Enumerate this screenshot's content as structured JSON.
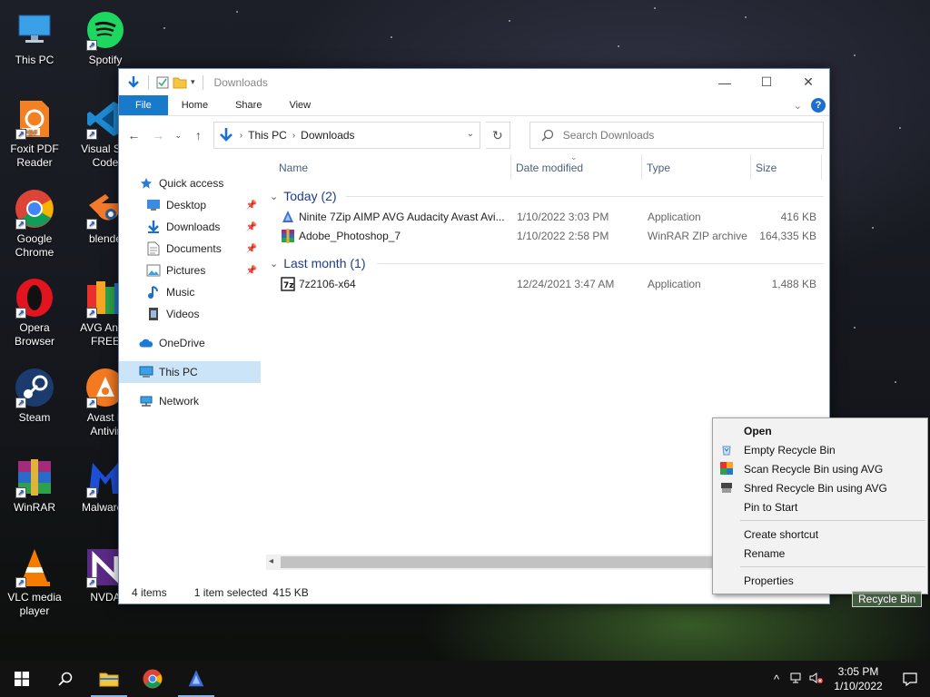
{
  "desktop": {
    "icons": [
      {
        "label": "This PC"
      },
      {
        "label": "Spotify"
      },
      {
        "label": "Foxit PDF\nReader"
      },
      {
        "label": "Visual Stu\nCode"
      },
      {
        "label": "Google\nChrome"
      },
      {
        "label": "blende"
      },
      {
        "label": "Opera\nBrowser"
      },
      {
        "label": "AVG AntiV\nFREE"
      },
      {
        "label": "Steam"
      },
      {
        "label": "Avast F\nAntivir"
      },
      {
        "label": "WinRAR"
      },
      {
        "label": "Malwareb"
      },
      {
        "label": "VLC media\nplayer"
      },
      {
        "label": "NVDA"
      }
    ],
    "recycle_bin_label": "Recycle Bin"
  },
  "explorer": {
    "title": "Downloads",
    "ribbon_tabs": [
      "File",
      "Home",
      "Share",
      "View"
    ],
    "address": {
      "root": "This PC",
      "current": "Downloads"
    },
    "search_placeholder": "Search Downloads",
    "nav": [
      {
        "label": "Quick access",
        "icon": "star-icon",
        "pinned": false
      },
      {
        "label": "Desktop",
        "icon": "desktop-folder-icon",
        "pinned": true
      },
      {
        "label": "Downloads",
        "icon": "downloads-folder-icon",
        "pinned": true
      },
      {
        "label": "Documents",
        "icon": "documents-folder-icon",
        "pinned": true
      },
      {
        "label": "Pictures",
        "icon": "pictures-folder-icon",
        "pinned": true
      },
      {
        "label": "Music",
        "icon": "music-icon",
        "pinned": false
      },
      {
        "label": "Videos",
        "icon": "videos-icon",
        "pinned": false
      },
      {
        "label": "OneDrive",
        "icon": "onedrive-icon",
        "pinned": false
      },
      {
        "label": "This PC",
        "icon": "this-pc-icon",
        "pinned": false,
        "selected": true
      },
      {
        "label": "Network",
        "icon": "network-icon",
        "pinned": false
      }
    ],
    "columns": {
      "name": "Name",
      "date": "Date modified",
      "type": "Type",
      "size": "Size"
    },
    "groups": [
      {
        "label": "Today (2)",
        "files": [
          {
            "name": "Ninite 7Zip AIMP AVG Audacity Avast Avi...",
            "date": "1/10/2022 3:03 PM",
            "type": "Application",
            "size": "416 KB",
            "icon": "ninite-app-icon"
          },
          {
            "name": "Adobe_Photoshop_7",
            "date": "1/10/2022 2:58 PM",
            "type": "WinRAR ZIP archive",
            "size": "164,335 KB",
            "icon": "winrar-archive-icon"
          }
        ]
      },
      {
        "label": "Last month (1)",
        "files": [
          {
            "name": "7z2106-x64",
            "date": "12/24/2021 3:47 AM",
            "type": "Application",
            "size": "1,488 KB",
            "icon": "sevenzip-app-icon"
          }
        ]
      }
    ],
    "status": {
      "items": "4 items",
      "selected": "1 item selected",
      "size": "415 KB"
    }
  },
  "context_menu": {
    "items": [
      {
        "label": "Open",
        "bold": true,
        "icon": ""
      },
      {
        "label": "Empty Recycle Bin",
        "icon": "recycle-icon"
      },
      {
        "label": "Scan Recycle Bin using AVG",
        "icon": "avg-scan-icon"
      },
      {
        "label": "Shred Recycle Bin using AVG",
        "icon": "avg-shred-icon"
      },
      {
        "label": "Pin to Start",
        "icon": ""
      },
      {
        "label": "Create shortcut",
        "icon": ""
      },
      {
        "label": "Rename",
        "icon": ""
      },
      {
        "label": "Properties",
        "icon": ""
      }
    ]
  },
  "taskbar": {
    "clock_time": "3:05 PM",
    "clock_date": "1/10/2022"
  },
  "colors": {
    "accent": "#1979ca",
    "selection": "#cce4f7",
    "group_header": "#1e3d8c"
  }
}
